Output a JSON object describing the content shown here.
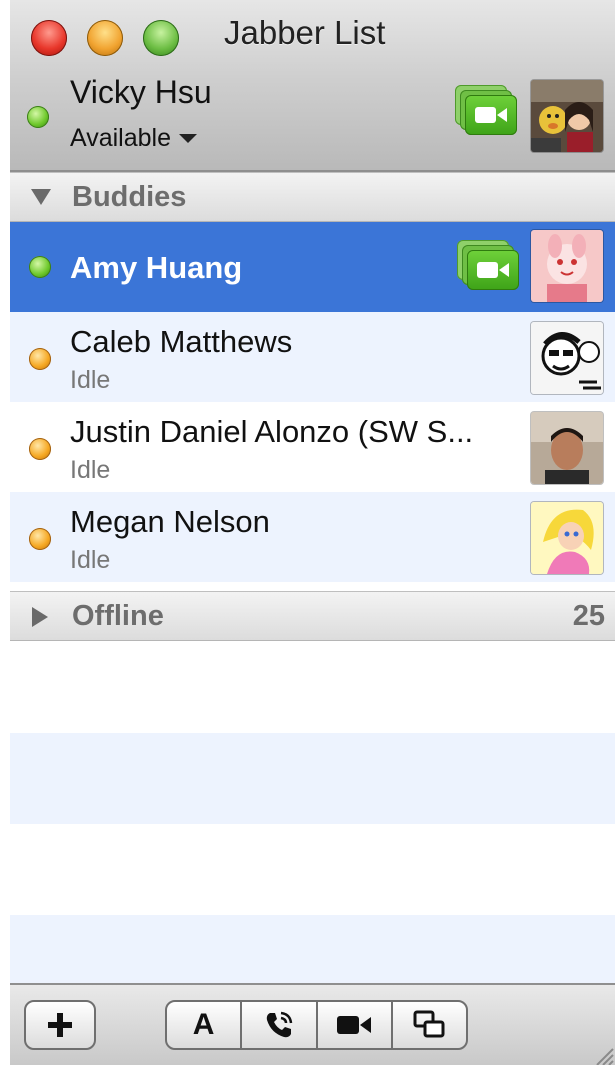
{
  "window": {
    "title": "Jabber List",
    "traffic_lights": [
      "close",
      "minimize",
      "zoom"
    ]
  },
  "account": {
    "name": "Vicky Hsu",
    "status": "Available",
    "status_color": "#6fc92c",
    "video_icon": "video-camera-icon"
  },
  "groups": {
    "buddies_label": "Buddies",
    "offline_label": "Offline",
    "offline_count": "25"
  },
  "buddies": [
    {
      "name": "Amy Huang",
      "status": "",
      "presence": "available",
      "video": true,
      "selected": true
    },
    {
      "name": "Caleb Matthews",
      "status": "Idle",
      "presence": "idle",
      "video": false,
      "selected": false
    },
    {
      "name": "Justin Daniel Alonzo (SW S...",
      "status": "Idle",
      "presence": "idle",
      "video": false,
      "selected": false
    },
    {
      "name": "Megan Nelson",
      "status": "Idle",
      "presence": "idle",
      "video": false,
      "selected": false
    }
  ],
  "toolbar": {
    "add_label": "+",
    "font_label": "A",
    "buttons": [
      "add-icon",
      "font-icon",
      "phone-icon",
      "video-camera-icon",
      "screen-share-icon"
    ]
  },
  "colors": {
    "selection": "#3b75d7",
    "alt_row": "#edf3fe",
    "available": "#6fc92c",
    "idle": "#f6a823",
    "video_green": "#4bb020"
  }
}
